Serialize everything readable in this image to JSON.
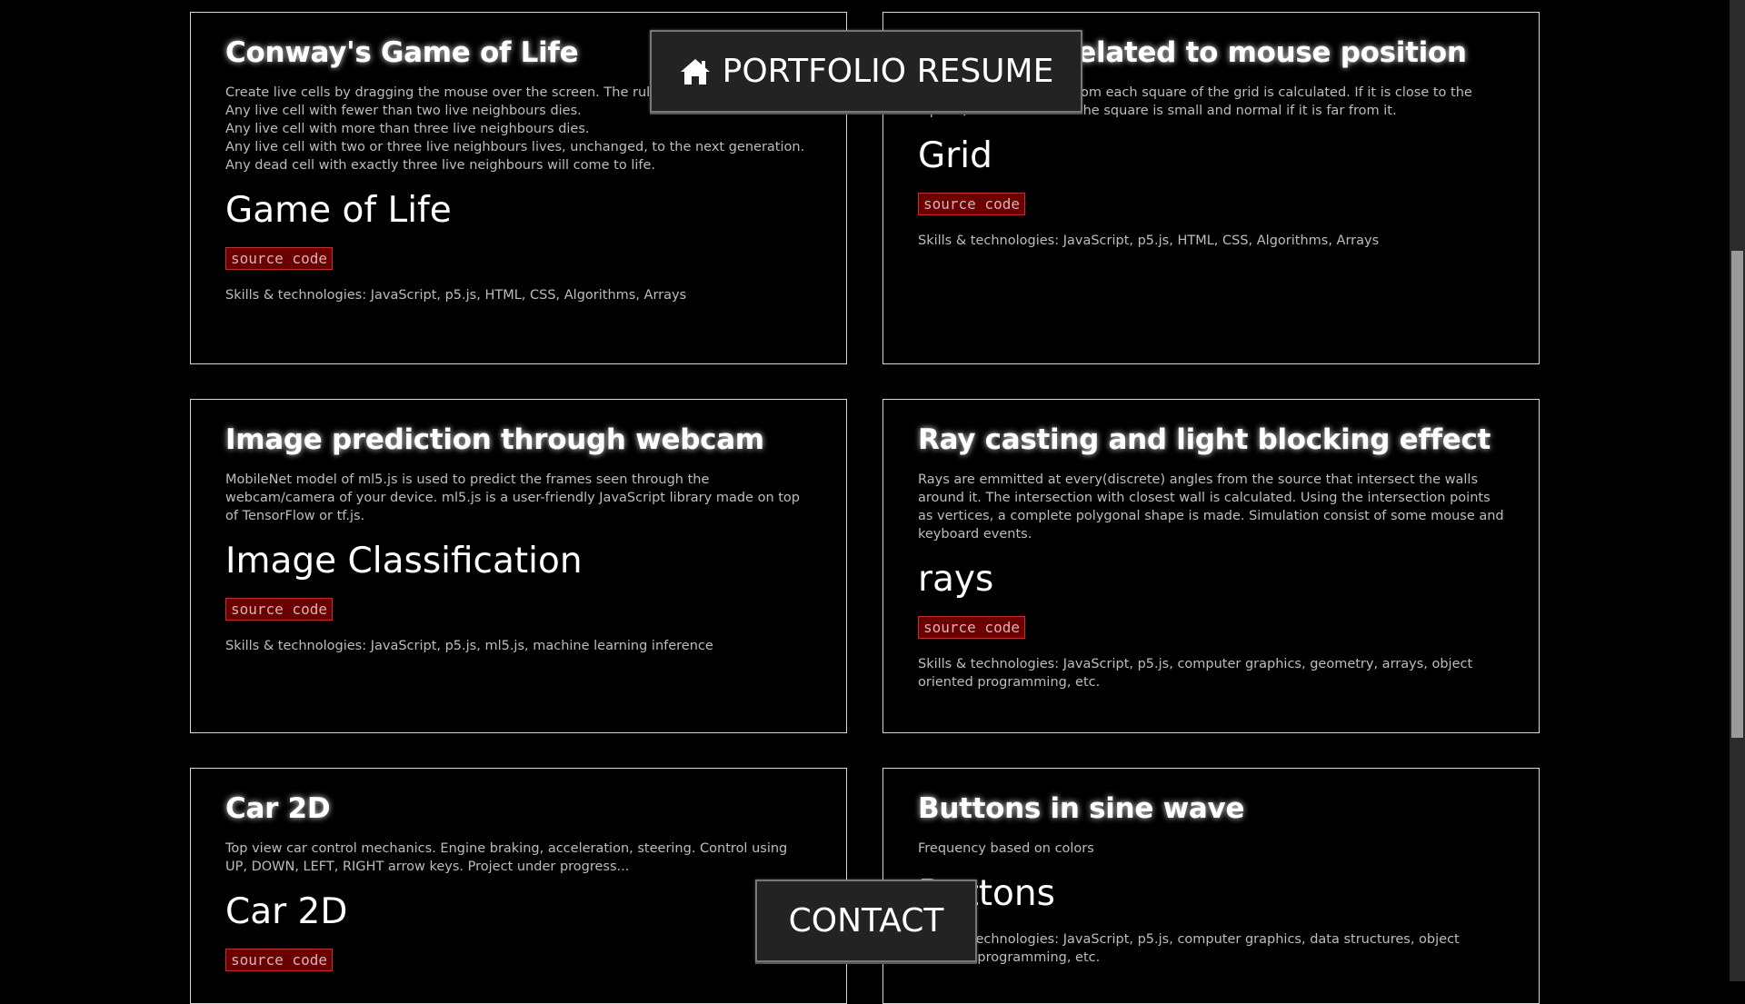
{
  "nav": {
    "portfolio_label": "PORTFOLIO RESUME",
    "contact_label": "CONTACT",
    "home_icon": "home-icon"
  },
  "projects": [
    {
      "title": "Conway's Game of Life",
      "description": [
        "Create live cells by dragging the mouse over the screen. The rules for evolution are:",
        "Any live cell with fewer than two live neighbours dies.",
        "Any live cell with more than three live neighbours dies.",
        "Any live cell with two or three live neighbours lives, unchanged, to the next generation.",
        "Any dead cell with exactly three live neighbours will come to life."
      ],
      "name": "Game of Life",
      "source_label": "source code",
      "skills": "Skills & technologies: JavaScript, p5.js, HTML, CSS, Algorithms, Arrays"
    },
    {
      "title": "Grid size related to mouse position",
      "description": [
        "Distance of the mouse from each square of the grid is calculated. If it is close to the square, then the size of the square is small and normal if it is far from it."
      ],
      "name": "Grid",
      "source_label": "source code",
      "skills": "Skills & technologies: JavaScript, p5.js, HTML, CSS, Algorithms, Arrays"
    },
    {
      "title": "Image prediction through webcam",
      "description": [
        "MobileNet model of ml5.js is used to predict the frames seen through the webcam/camera of your device. ml5.js is a user-friendly JavaScript library made on top of TensorFlow or tf.js."
      ],
      "name": "Image Classification",
      "source_label": "source code",
      "skills": "Skills & technologies: JavaScript, p5.js, ml5.js, machine learning inference"
    },
    {
      "title": "Ray casting and light blocking effect",
      "description": [
        "Rays are emmitted at every(discrete) angles from the source that intersect the walls around it. The intersection with closest wall is calculated. Using the intersection points as vertices, a complete polygonal shape is made. Simulation consist of some mouse and keyboard events."
      ],
      "name": "rays",
      "source_label": "source code",
      "skills": "Skills & technologies: JavaScript, p5.js, computer graphics, geometry, arrays, object oriented programming, etc."
    },
    {
      "title": "Car 2D",
      "description": [
        "Top view car control mechanics. Engine braking, acceleration, steering. Control using UP, DOWN, LEFT, RIGHT arrow keys. Project under progress..."
      ],
      "name": "Car 2D",
      "source_label": "source code",
      "skills": ""
    },
    {
      "title": "Buttons in sine wave",
      "description": [
        "Frequency based on colors"
      ],
      "name": "Buttons",
      "source_label": "",
      "skills": "Skills & technologies: JavaScript, p5.js, computer graphics, data structures, object oriented programming, etc."
    }
  ]
}
